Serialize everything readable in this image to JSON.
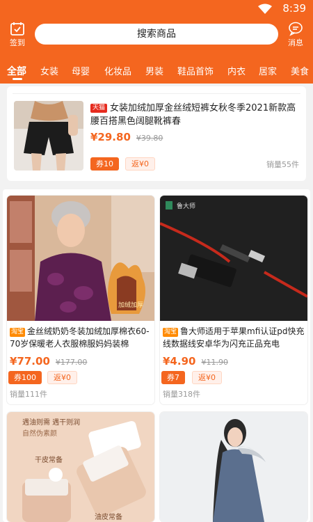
{
  "status": {
    "time": "8:39"
  },
  "header": {
    "checkin_label": "签到",
    "search_placeholder": "搜索商品",
    "message_label": "消息"
  },
  "tabs": [
    {
      "label": "全部",
      "active": true
    },
    {
      "label": "女装"
    },
    {
      "label": "母婴"
    },
    {
      "label": "化妆品"
    },
    {
      "label": "男装"
    },
    {
      "label": "鞋品首饰"
    },
    {
      "label": "内衣"
    },
    {
      "label": "居家"
    },
    {
      "label": "美食"
    }
  ],
  "featured": {
    "badge": "天猫",
    "title": "女装加绒加厚金丝绒短裤女秋冬季2021新款高腰百搭黑色阔腿靴裤春",
    "price": "¥29.80",
    "old_price": "¥39.80",
    "coupon": "券10",
    "rebate": "返¥0",
    "sold": "销量55件"
  },
  "products": [
    {
      "badge": "淘宝",
      "title": "金丝绒奶奶冬装加绒加厚棉衣60-70岁保暖老人衣服棉服妈妈装棉",
      "price": "¥77.00",
      "old_price": "¥177.00",
      "coupon": "券100",
      "rebate": "返¥0",
      "sold": "销量111件",
      "image_text": "加绒加厚"
    },
    {
      "badge": "淘宝",
      "title": "鲁大师适用于苹果mfi认证pd快充线数据线安卓华为闪充正品充电",
      "price": "¥4.90",
      "old_price": "¥11.90",
      "coupon": "券7",
      "rebate": "返¥0",
      "sold": "销量318件",
      "image_text": "鲁大师"
    },
    {
      "image_text": [
        "遇油则需 遇干则润",
        "自然伪素颜",
        "干皮常备",
        "油皮常备"
      ]
    },
    {}
  ],
  "colors": {
    "brand": "#f4661f",
    "tmall": "#e62b1e",
    "taobao": "#ff8a00"
  }
}
